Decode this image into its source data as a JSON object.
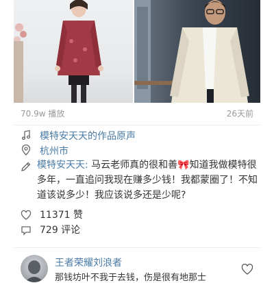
{
  "video": {
    "play_count": "70.9w 播放",
    "time_ago": "26天前"
  },
  "info": {
    "music_label": "模特安天天的作品原声",
    "location_label": "杭州市",
    "author": "模特安天天:",
    "text_before_emoji": "马云老师真的很和善",
    "emoji": "🎀",
    "text_after_emoji": "知道我做模特很多年，一直追问我现在赚多少钱！我都蒙圈了！不知道该说多少！我应该说多还是少呢?"
  },
  "stats": {
    "likes": "11371 赞",
    "comments": "729 评论"
  },
  "comment": {
    "username": "王者荣耀刘浪者",
    "text": "那钱坊叶不我于去钱，伤是很有地那士"
  },
  "icons": [
    "music-note-icon",
    "location-pin-icon",
    "pencil-icon",
    "heart-icon",
    "comment-bubble-icon"
  ]
}
